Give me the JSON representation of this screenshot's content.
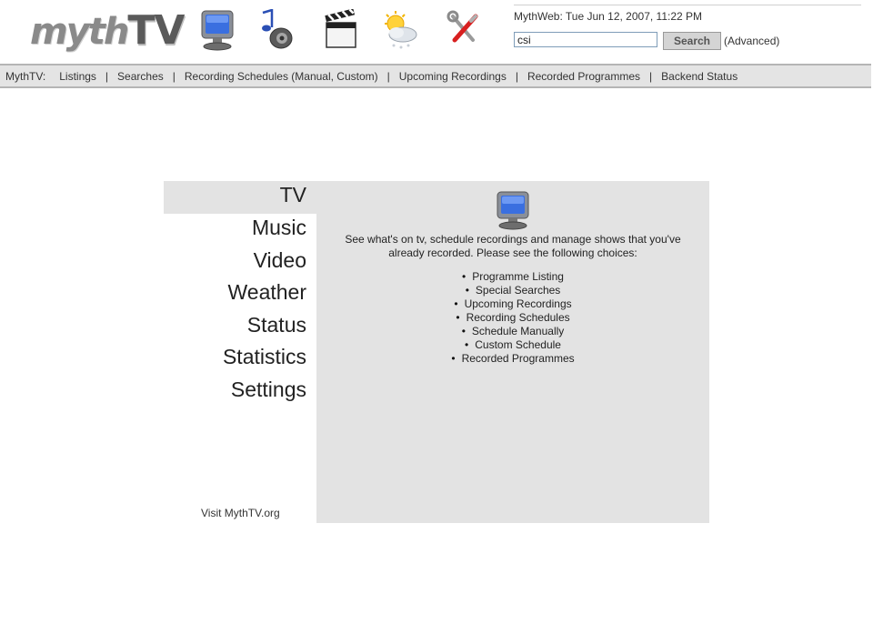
{
  "logo": {
    "myth": "myth",
    "tv": "TV"
  },
  "header": {
    "icons": [
      "tv-icon",
      "music-icon",
      "video-icon",
      "weather-icon",
      "settings-icon"
    ],
    "status": "MythWeb: Tue Jun 12, 2007, 11:22 PM",
    "search_value": "csi",
    "search_button": "Search",
    "advanced": "(Advanced)"
  },
  "nav": {
    "brand": "MythTV:",
    "items": [
      "Listings",
      "Searches",
      "Recording Schedules (Manual, Custom)",
      "Upcoming Recordings",
      "Recorded Programmes",
      "Backend Status"
    ]
  },
  "menu": {
    "items": [
      "TV",
      "Music",
      "Video",
      "Weather",
      "Status",
      "Statistics",
      "Settings"
    ],
    "active": "TV",
    "visit": "Visit MythTV.org"
  },
  "content": {
    "icon": "tv-icon",
    "description": "See what's on tv, schedule recordings and manage shows that you've already recorded. Please see the following choices:",
    "choices": [
      "Programme Listing",
      "Special Searches",
      "Upcoming Recordings",
      "Recording Schedules",
      "Schedule Manually",
      "Custom Schedule",
      "Recorded Programmes"
    ]
  },
  "colors": {
    "panel_bg": "#e3e3e3",
    "nav_bg": "#e4e4e4",
    "text": "#222222"
  }
}
